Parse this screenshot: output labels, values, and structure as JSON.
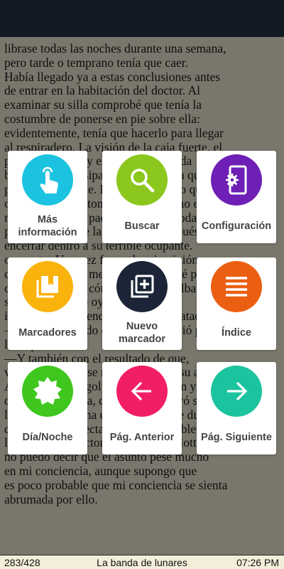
{
  "book": {
    "text": "librase todas las noches durante una semana,\npero tarde o temprano tenía que caer.\nHabía llegado ya a estas conclusiones antes\nde entrar en la habitación del doctor. Al\nexaminar su silla comprobé que tenía la\ncostumbre de ponerse en pie sobre ella:\nevidentemente, tenía que hacerlo para llegar\nal respiradero. La visión de la caja fuerte, el\nplatillo de leche y el lazo de la cuerda\nbastaron para disipar cualquier duda que\npudiera quedarme. El ruido metálico que\noyó la señorita Stoner se debía, como es\nnatural, a que su padrastro cerró a toda\nprisa la puerta de la caja fuerte después de\nencerrar dentro a su terrible ocupante.\nocupante. Una vez formada mi opinión, ya\nconoce usted las medidas que adopté para\ncomprobarla. Oí cómo la criatura silbaba, y\nsin duda usted lo oyó también, y\ninmediatamente encendí la luz y la ataqué.\n—Con el resultado de que se revolvió por\nla respiración.\n—Y también con el resultado de que,\nvez al otro lado, se revolvió contra su amo.\nAlgunos de mis golpes le alcanzaron y\ndespertaron su ira, de modo que cayó sobre\nla primera persona que vio. No cabe duda\nde que soy indirectamente responsable de\nla muerte del doctor Grimesby Roylott, y\nno puedo decir que el asunto pese mucho\nen mi conciencia, aunque supongo que\nes poco probable que mi conciencia se sienta\nabrumada por ello."
  },
  "footer": {
    "page": "283/428",
    "title": "La banda de lunares",
    "time": "07:26 PM"
  },
  "menu": [
    {
      "label": "Más\ninformación",
      "icon": "touch-icon",
      "color": "#1cc3e0"
    },
    {
      "label": "Buscar",
      "icon": "search-icon",
      "color": "#8bc71c"
    },
    {
      "label": "Configuración",
      "icon": "settings-phone-icon",
      "color": "#6e1fb5"
    },
    {
      "label": "Marcadores",
      "icon": "bookmarks-icon",
      "color": "#fab20d"
    },
    {
      "label": "Nuevo\nmarcador",
      "icon": "add-bookmark-icon",
      "color": "#1c2437"
    },
    {
      "label": "Índice",
      "icon": "index-icon",
      "color": "#eb5f12"
    },
    {
      "label": "Día/Noche",
      "icon": "day-night-icon",
      "color": "#3fc71f"
    },
    {
      "label": "Pág. Anterior",
      "icon": "arrow-left-icon",
      "color": "#f21e63"
    },
    {
      "label": "Pág. Siguiente",
      "icon": "arrow-right-icon",
      "color": "#1cc39f"
    }
  ]
}
